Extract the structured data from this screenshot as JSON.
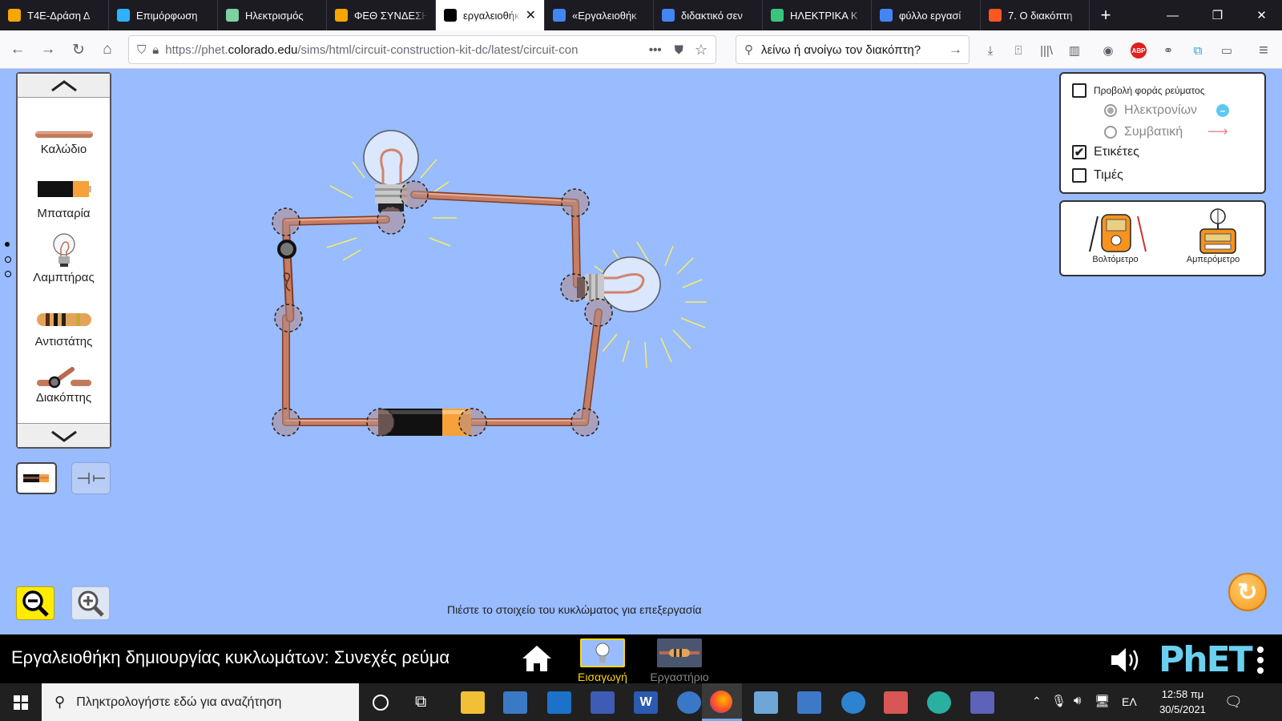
{
  "browser": {
    "tabs": [
      {
        "label": "Τ4Ε-Δράση Δ",
        "icon": "moodle-owl-icon",
        "color": "#f7a600"
      },
      {
        "label": "Επιμόρφωση",
        "icon": "t-logo-icon",
        "color": "#2eb1ff"
      },
      {
        "label": "Ηλεκτρισμός",
        "icon": "circle-logo-icon",
        "color": "#7fd0a0"
      },
      {
        "label": "ΦΕΘ ΣΥΝΔΕΣΗ",
        "icon": "moodle-owl-icon",
        "color": "#f7a600"
      },
      {
        "label": "εργαλειοθήκη",
        "icon": "phet-icon",
        "color": "#000000"
      },
      {
        "label": "«Εργαλειοθήκ",
        "icon": "google-icon",
        "color": "#4285f4"
      },
      {
        "label": "διδακτικό σεν",
        "icon": "google-icon",
        "color": "#4285f4"
      },
      {
        "label": "ΗΛΕΚΤΡΙΚΑ Κ",
        "icon": "wikispaces-icon",
        "color": "#3ac57e"
      },
      {
        "label": "φύλλο εργασί",
        "icon": "google-icon",
        "color": "#4285f4"
      },
      {
        "label": "7. Ο διακόπτη",
        "icon": "blogger-icon",
        "color": "#ff5722"
      }
    ],
    "active_tab": 4,
    "url_prefix": "https://phet.",
    "url_domain": "colorado.edu",
    "url_path": "/sims/html/circuit-construction-kit-dc/latest/circuit-con",
    "search_text": "λείνω ή ανοίγω τον διακόπτη?"
  },
  "toolbox": {
    "items": [
      {
        "label": "Καλώδιο",
        "icon": "wire-icon"
      },
      {
        "label": "Μπαταρία",
        "icon": "battery-icon"
      },
      {
        "label": "Λαμπτήρας",
        "icon": "lightbulb-icon"
      },
      {
        "label": "Αντιστάτης",
        "icon": "resistor-icon"
      },
      {
        "label": "Διακόπτης",
        "icon": "switch-icon"
      }
    ]
  },
  "options": {
    "show_current": "Προβολή φοράς ρεύματος",
    "electrons": "Ηλεκτρονίων",
    "conventional": "Συμβατική",
    "labels": "Ετικέτες",
    "values": "Τιμές",
    "show_current_checked": false,
    "labels_checked": true,
    "values_checked": false
  },
  "meters": {
    "voltmeter": "Βολτόμετρο",
    "ammeter": "Αμπερόμετρο"
  },
  "hint": "Πιέστε το στοιχείο του κυκλώματος για επεξεργασία",
  "navbar": {
    "title": "Εργαλειοθήκη δημιουργίας κυκλωμάτων: Συνεχές ρεύμα",
    "screens": [
      "Εισαγωγή",
      "Εργαστήριο"
    ],
    "active_screen": 0,
    "brand": "PhET"
  },
  "taskbar": {
    "search_placeholder": "Πληκτρολογήστε εδώ για αναζήτηση",
    "lang": "ΕΛ",
    "time": "12:58 πμ",
    "date": "30/5/2021"
  },
  "colors": {
    "sim_bg": "#99bbff",
    "wire": "#b87333",
    "phet_blue": "#6bd0ef",
    "active_screen": "#ffd700"
  }
}
